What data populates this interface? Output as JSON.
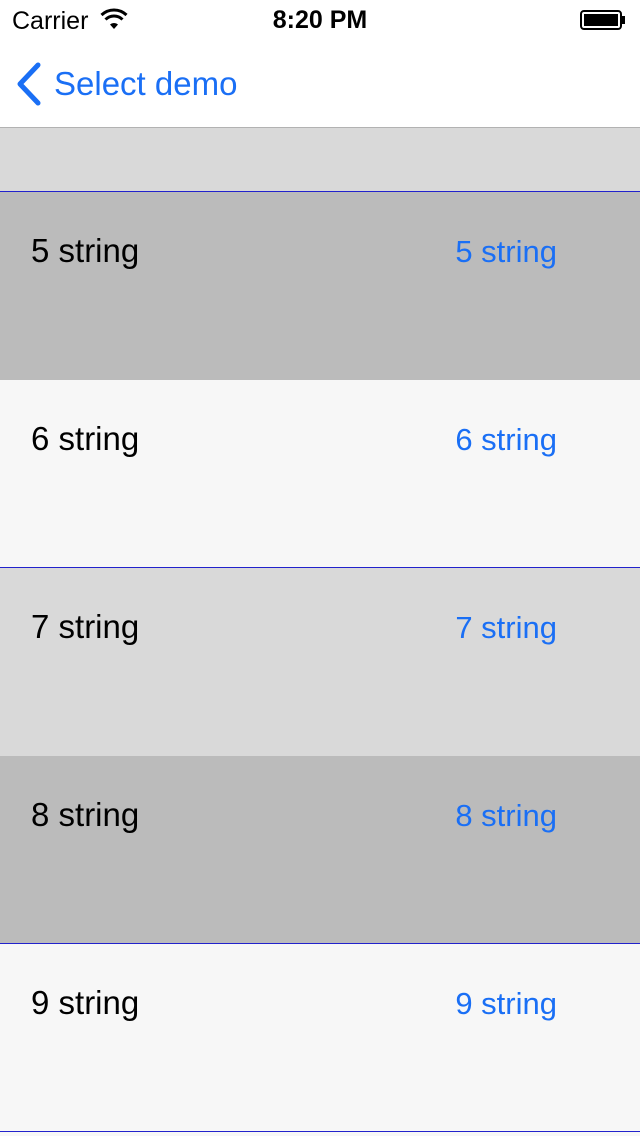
{
  "status_bar": {
    "carrier": "Carrier",
    "time": "8:20 PM"
  },
  "nav": {
    "back_label": "Select demo"
  },
  "colors": {
    "accent": "#1a6ff5",
    "row_dark": "#bbbbbb",
    "row_light": "#f7f7f7",
    "row_mid": "#d9d9d9",
    "separator": "#2222cc"
  },
  "rows": [
    {
      "title": "5 string",
      "value": "5 string"
    },
    {
      "title": "6 string",
      "value": "6 string"
    },
    {
      "title": "7 string",
      "value": "7 string"
    },
    {
      "title": "8 string",
      "value": "8 string"
    },
    {
      "title": "9 string",
      "value": "9 string"
    }
  ]
}
